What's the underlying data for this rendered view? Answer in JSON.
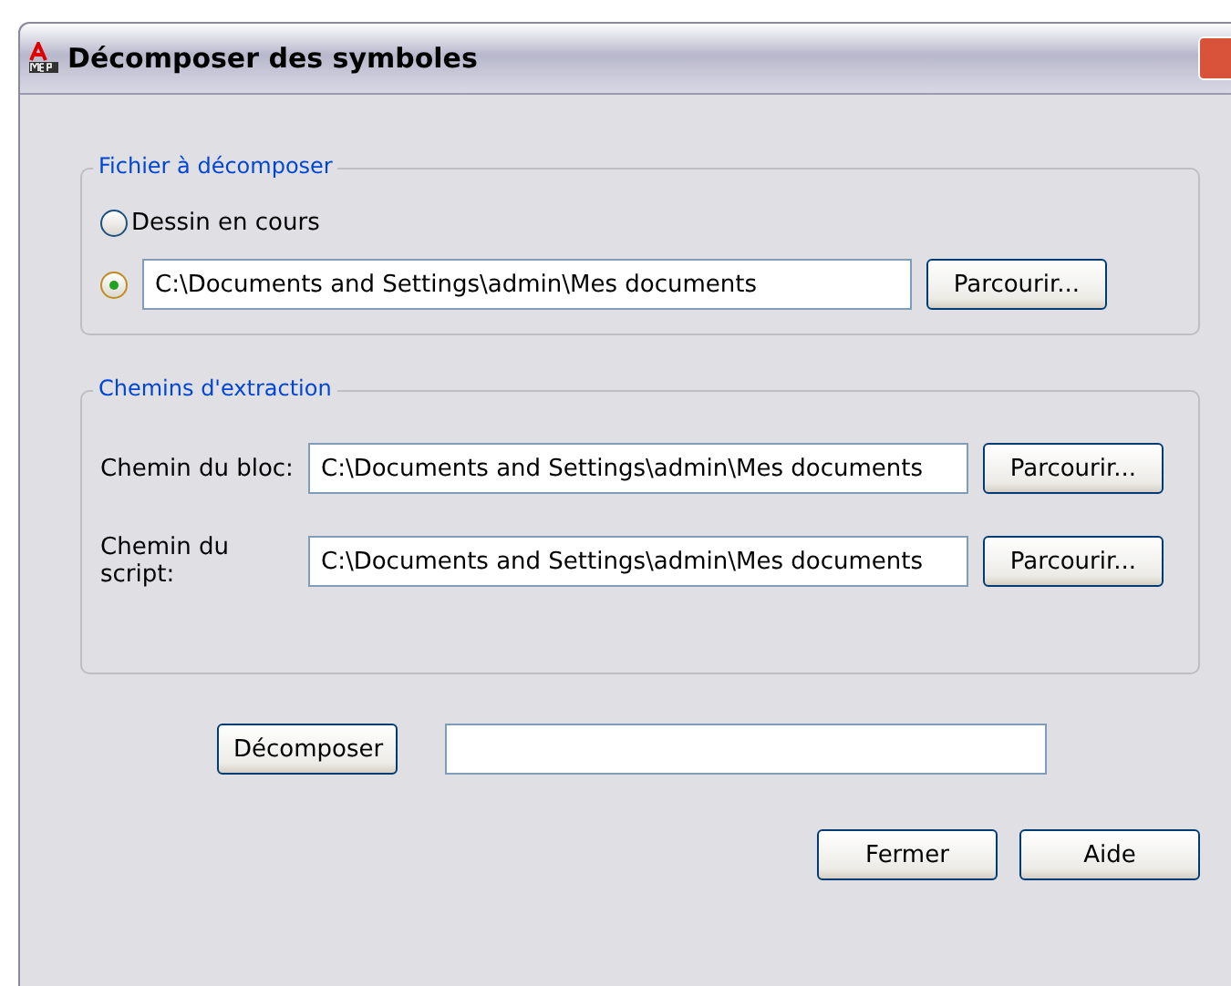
{
  "window": {
    "title": "Décomposer des symboles"
  },
  "source_group": {
    "title": "Fichier à décomposer",
    "options": [
      {
        "kind": "label",
        "label": "Dessin en cours",
        "selected": false
      },
      {
        "kind": "path",
        "value": "C:\\Documents and Settings\\admin\\Mes documents",
        "button": "Parcourir...",
        "selected": true
      }
    ]
  },
  "paths_group": {
    "title": "Chemins d'extraction",
    "rows": [
      {
        "label": "Chemin du bloc:",
        "value": "C:\\Documents and Settings\\admin\\Mes documents",
        "button": "Parcourir..."
      },
      {
        "label": "Chemin du script:",
        "value": "C:\\Documents and Settings\\admin\\Mes documents",
        "button": "Parcourir..."
      }
    ]
  },
  "action": {
    "button": "Décomposer"
  },
  "footer_buttons": [
    "Fermer",
    "Aide"
  ]
}
